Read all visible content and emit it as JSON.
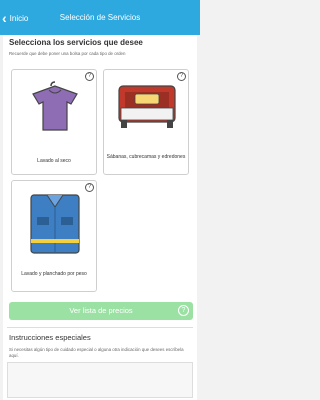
{
  "header": {
    "back_label": "Inicio",
    "title": "Selección de Servicios"
  },
  "main": {
    "heading": "Selecciona los servicios que desee",
    "note": "Recuerde que debe poner una bolsa por cada tipo de orden",
    "services": [
      {
        "label": "Lavado al seco",
        "icon": "shirt-icon"
      },
      {
        "label": "Sábanas, cubrecamas y edredones",
        "icon": "bed-icon"
      },
      {
        "label": "Lavado y planchado por peso",
        "icon": "folded-shirt-icon"
      }
    ],
    "help_symbol": "?",
    "button_label": "Ver lista de precios"
  },
  "instructions": {
    "title": "Instrucciones especiales",
    "note": "Si necesitas algún tipo de cuidado especial o alguna otra indicación que desees escríbela aquí."
  },
  "colors": {
    "header": "#2ea9e0",
    "button": "#9be1a3",
    "shirt": "#8e6db5",
    "bed": "#c0392b",
    "folded": "#3d7fc2"
  }
}
